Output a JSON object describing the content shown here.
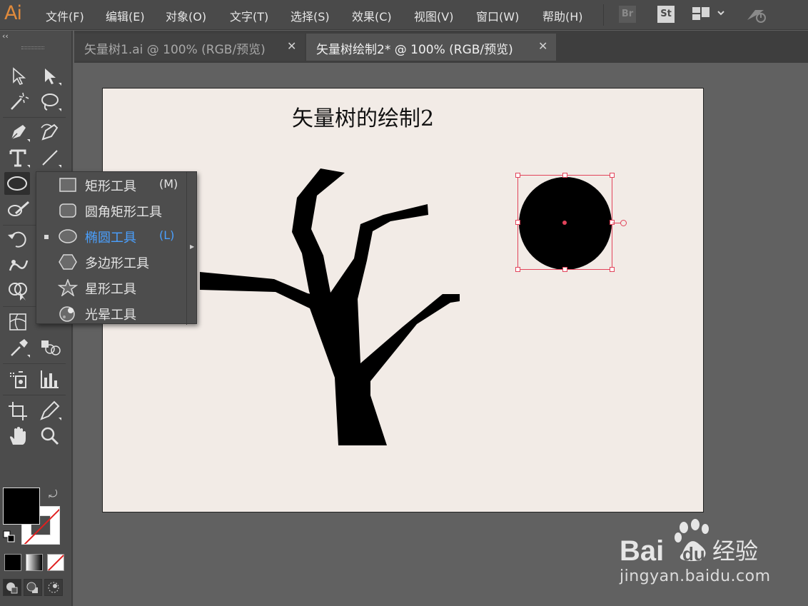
{
  "app": {
    "logo": "Ai"
  },
  "menu": [
    {
      "label": "文件(F)",
      "key": "file"
    },
    {
      "label": "编辑(E)",
      "key": "edit"
    },
    {
      "label": "对象(O)",
      "key": "object"
    },
    {
      "label": "文字(T)",
      "key": "type"
    },
    {
      "label": "选择(S)",
      "key": "select"
    },
    {
      "label": "效果(C)",
      "key": "effect"
    },
    {
      "label": "视图(V)",
      "key": "view"
    },
    {
      "label": "窗口(W)",
      "key": "window"
    },
    {
      "label": "帮助(H)",
      "key": "help"
    }
  ],
  "menubar_icons": {
    "bridge": "Br",
    "stock": "St"
  },
  "panel": {
    "collapse": "‹‹"
  },
  "tabs": [
    {
      "label": "矢量树1.ai @ 100% (RGB/预览)",
      "close": "✕",
      "active": false
    },
    {
      "label": "矢量树绘制2* @ 100% (RGB/预览)",
      "close": "✕",
      "active": true
    }
  ],
  "artboard": {
    "title": "矢量树的绘制2",
    "background": "#f2ebe6"
  },
  "flyout": {
    "items": [
      {
        "label": "矩形工具",
        "shortcut": "(M)",
        "icon": "rectangle-icon",
        "selected": false
      },
      {
        "label": "圆角矩形工具",
        "shortcut": "",
        "icon": "rounded-rectangle-icon",
        "selected": false
      },
      {
        "label": "椭圆工具",
        "shortcut": "(L)",
        "icon": "ellipse-icon",
        "selected": true
      },
      {
        "label": "多边形工具",
        "shortcut": "",
        "icon": "polygon-icon",
        "selected": false
      },
      {
        "label": "星形工具",
        "shortcut": "",
        "icon": "star-icon",
        "selected": false
      },
      {
        "label": "光晕工具",
        "shortcut": "",
        "icon": "flare-icon",
        "selected": false
      }
    ]
  },
  "colors": {
    "fill": "#000000",
    "stroke": "none",
    "accent": "#4aa0ff",
    "selection": "#e2435a"
  },
  "watermark": {
    "brand": "Baidu经验",
    "url": "jingyan.baidu.com"
  }
}
